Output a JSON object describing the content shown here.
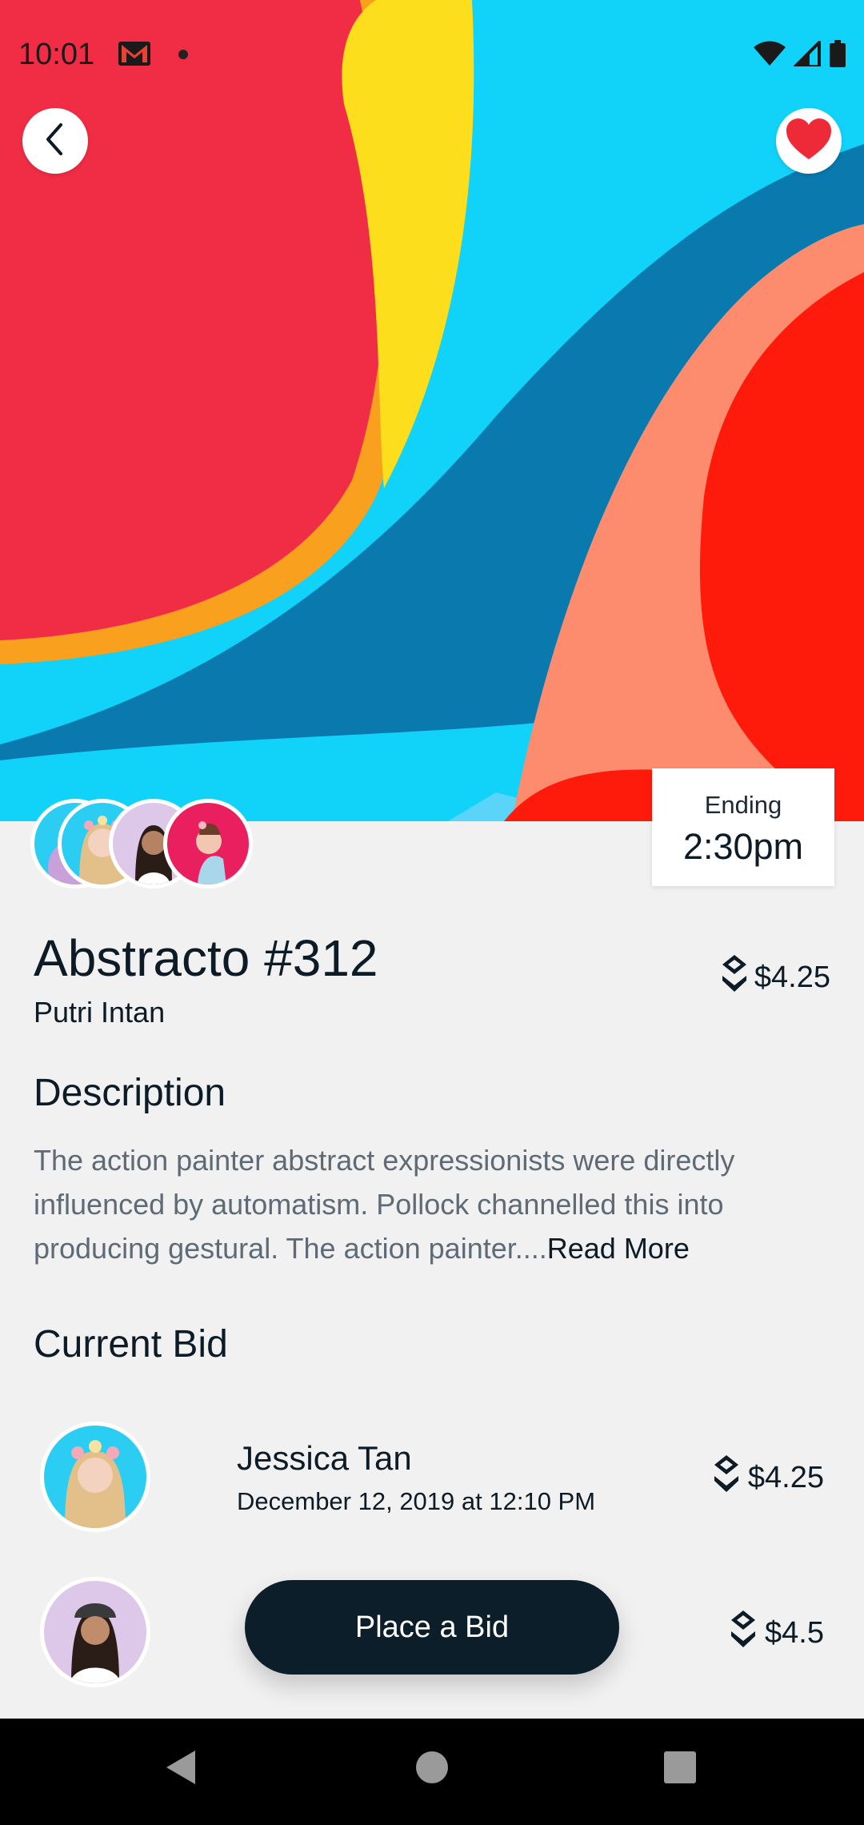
{
  "status_bar": {
    "time": "10:01"
  },
  "artwork": {
    "title": "Abstracto #312",
    "artist": "Putri Intan",
    "price": "$4.25",
    "ending_label": "Ending",
    "ending_time": "2:30pm"
  },
  "description": {
    "heading": "Description",
    "text": "The action painter abstract expressionists were directly influenced by automatism. Pollock channelled this into producing gestural. The action painter....",
    "read_more": "Read More"
  },
  "current_bid": {
    "heading": "Current Bid",
    "bids": [
      {
        "name": "Jessica Tan",
        "date": "December 12, 2019 at 12:10 PM",
        "amount": "$4.25"
      },
      {
        "name": "",
        "date": "",
        "amount": "$4.5"
      }
    ]
  },
  "place_bid_label": "Place a Bid",
  "colors": {
    "primary_dark": "#0c1e29",
    "heart_red": "#ee2938",
    "background": "#f1f1f1"
  },
  "icons": [
    "back-arrow-icon",
    "heart-icon",
    "currency-icon",
    "gmail-icon",
    "wifi-icon",
    "signal-icon",
    "battery-icon"
  ]
}
